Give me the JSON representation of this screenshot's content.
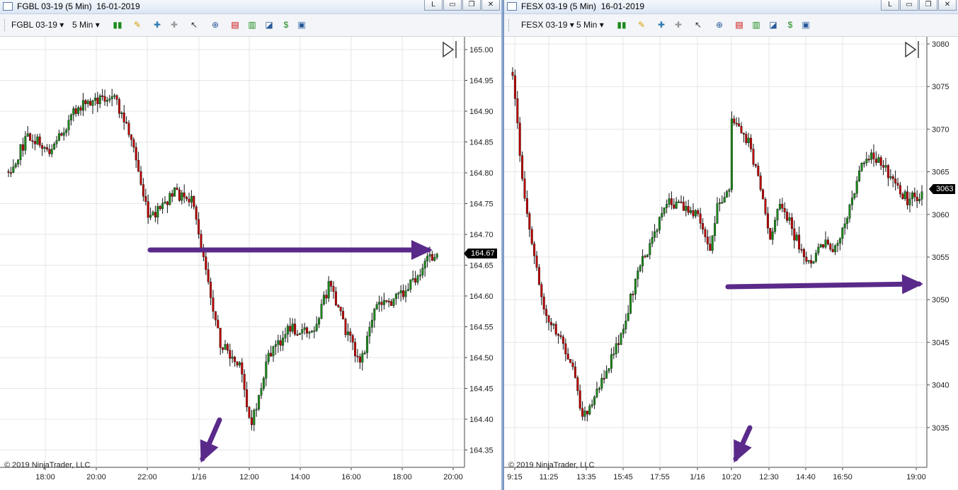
{
  "left": {
    "title": "FGBL 03-19 (5 Min)  16-01-2019",
    "instrument": "FGBL 03-19",
    "period": "5 Min",
    "price_axis": [
      "165.00",
      "164.95",
      "164.90",
      "164.85",
      "164.80",
      "164.75",
      "164.70",
      "164.65",
      "164.60",
      "164.55",
      "164.50",
      "164.45",
      "164.40",
      "164.35"
    ],
    "time_axis": [
      "18:00",
      "20:00",
      "22:00",
      "1/16",
      "12:00",
      "14:00",
      "16:00",
      "18:00",
      "20:00"
    ],
    "last_price": "164.67",
    "copyright": "© 2019 NinjaTrader, LLC"
  },
  "right": {
    "title": "FESX 03-19 (5 Min)  16-01-2019",
    "instrument": "FESX 03-19",
    "period": "5 Min",
    "price_axis": [
      "3080",
      "3075",
      "3070",
      "3065",
      "3060",
      "3055",
      "3050",
      "3045",
      "3040",
      "3035"
    ],
    "time_axis": [
      "9:15",
      "11:25",
      "13:35",
      "15:45",
      "17:55",
      "1/16",
      "10:20",
      "12:30",
      "14:40",
      "16:50",
      "19:00"
    ],
    "last_price": "3063",
    "copyright": "© 2019 NinjaTrader, LLC"
  },
  "window_buttons": {
    "restore": "L",
    "minimize": "▭",
    "maximize": "❐",
    "close": "✕"
  },
  "colors": {
    "up": "#1a8a1a",
    "down": "#c00000",
    "arrow": "#5a2a8a",
    "grid": "#e6e6e6"
  },
  "toolbar_icons": [
    "chart-style-icon",
    "drawing-tool-icon",
    "add-indicator-icon",
    "remove-indicator-icon",
    "pointer-icon",
    "zoom-icon",
    "indicators-icon",
    "strategies-icon",
    "chart-trader-icon",
    "dollar-icon",
    "properties-icon"
  ]
}
